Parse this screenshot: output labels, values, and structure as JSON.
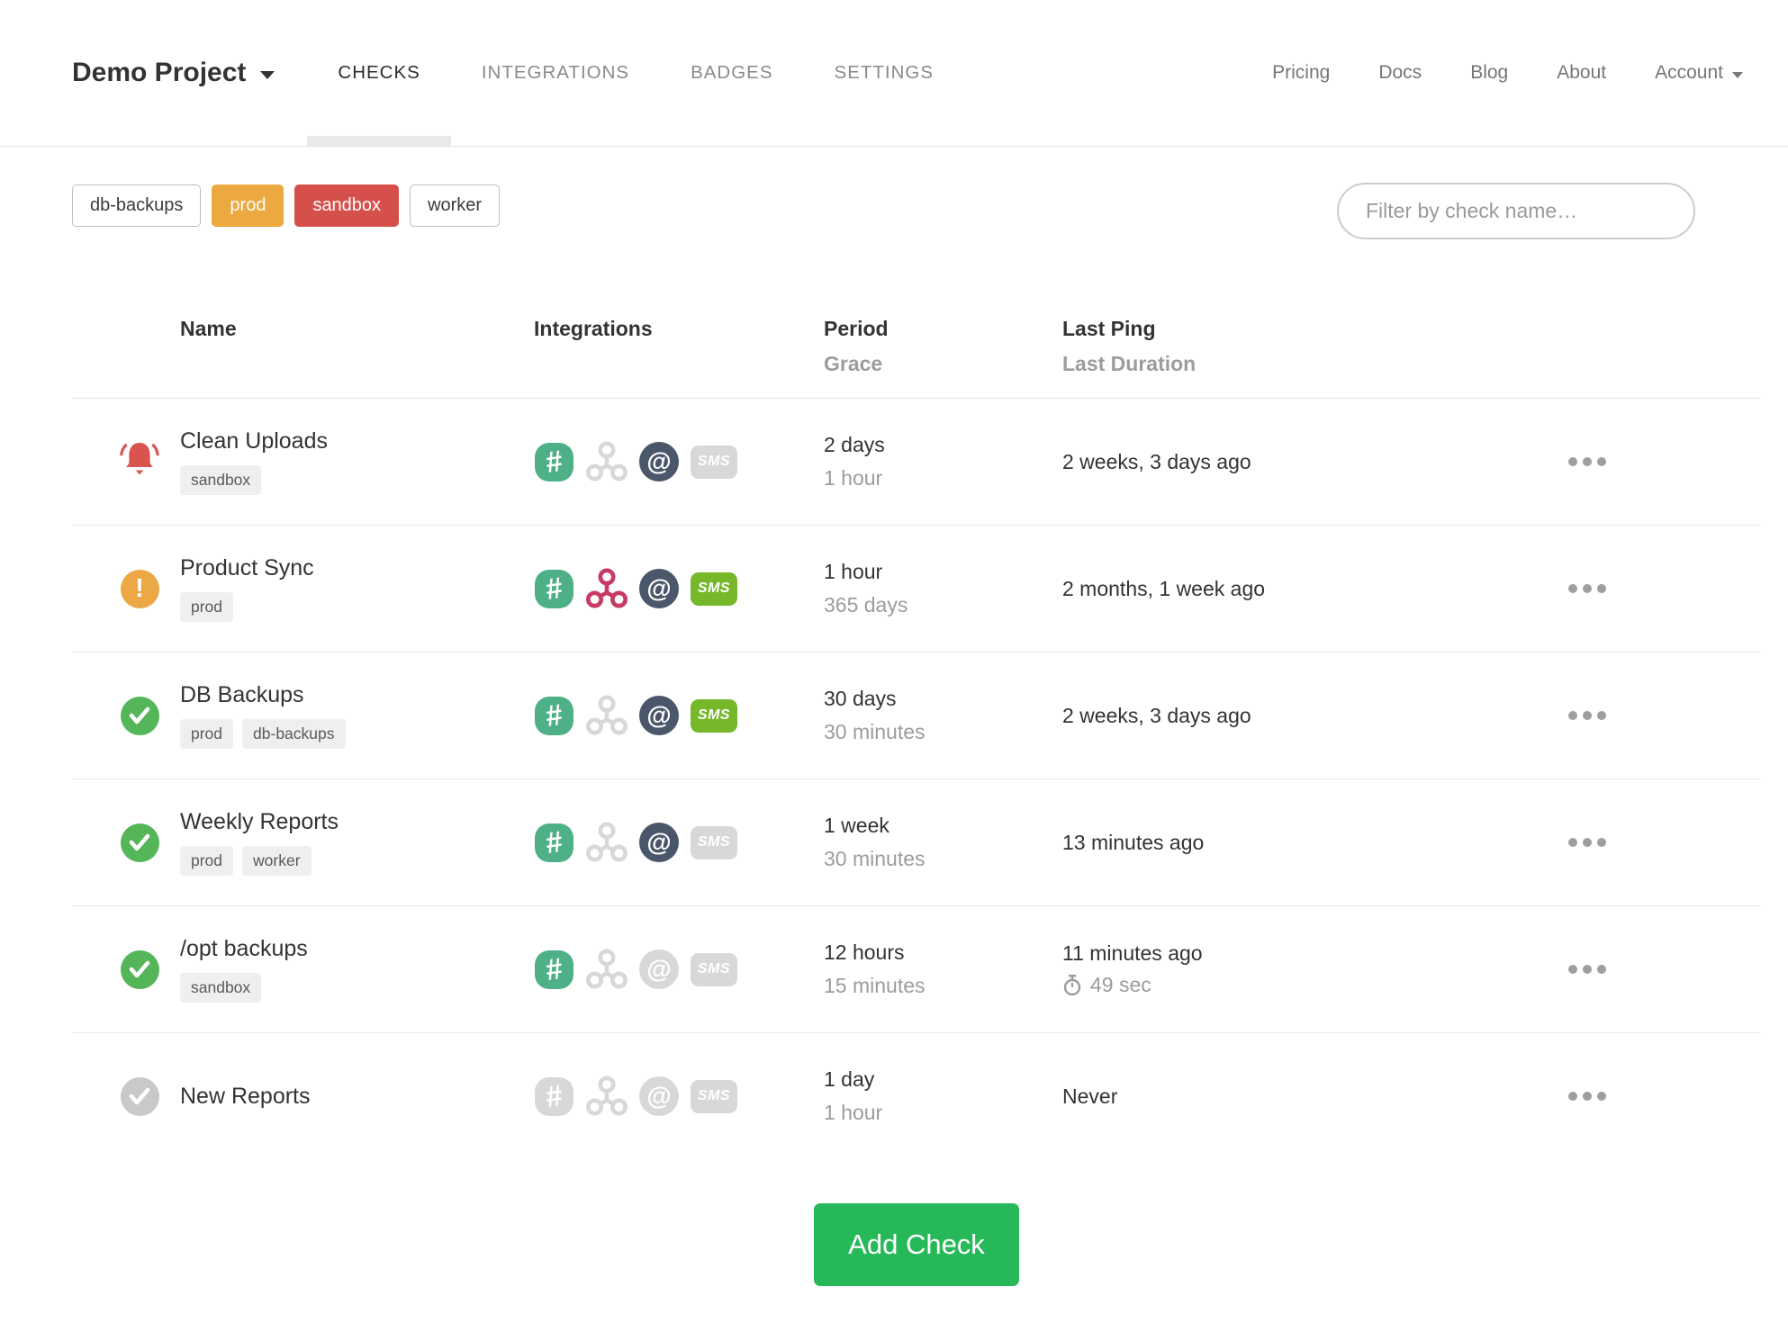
{
  "nav": {
    "project_name": "Demo Project",
    "tabs": [
      {
        "label": "CHECKS",
        "active": true
      },
      {
        "label": "INTEGRATIONS",
        "active": false
      },
      {
        "label": "BADGES",
        "active": false
      },
      {
        "label": "SETTINGS",
        "active": false
      }
    ],
    "links": [
      "Pricing",
      "Docs",
      "Blog",
      "About"
    ],
    "account_label": "Account"
  },
  "filters": {
    "tags": [
      {
        "label": "db-backups",
        "variant": "outline"
      },
      {
        "label": "prod",
        "variant": "warning"
      },
      {
        "label": "sandbox",
        "variant": "danger"
      },
      {
        "label": "worker",
        "variant": "outline"
      }
    ],
    "search_placeholder": "Filter by check name…"
  },
  "table": {
    "headers": {
      "name": "Name",
      "integrations": "Integrations",
      "period": "Period",
      "grace": "Grace",
      "last_ping": "Last Ping",
      "last_duration": "Last Duration"
    },
    "rows": [
      {
        "status": "alert",
        "name": "Clean Uploads",
        "tags": [
          "sandbox"
        ],
        "integrations": [
          {
            "type": "slack",
            "active": true
          },
          {
            "type": "webhook",
            "active": false
          },
          {
            "type": "email",
            "active": true
          },
          {
            "type": "sms",
            "active": false
          }
        ],
        "period": "2 days",
        "grace": "1 hour",
        "last_ping": "2 weeks, 3 days ago",
        "last_duration": ""
      },
      {
        "status": "warning",
        "name": "Product Sync",
        "tags": [
          "prod"
        ],
        "integrations": [
          {
            "type": "slack",
            "active": true
          },
          {
            "type": "webhook",
            "active": true
          },
          {
            "type": "email",
            "active": true
          },
          {
            "type": "sms",
            "active": true
          }
        ],
        "period": "1 hour",
        "grace": "365 days",
        "last_ping": "2 months, 1 week ago",
        "last_duration": ""
      },
      {
        "status": "ok",
        "name": "DB Backups",
        "tags": [
          "prod",
          "db-backups"
        ],
        "integrations": [
          {
            "type": "slack",
            "active": true
          },
          {
            "type": "webhook",
            "active": false
          },
          {
            "type": "email",
            "active": true
          },
          {
            "type": "sms",
            "active": true
          }
        ],
        "period": "30 days",
        "grace": "30 minutes",
        "last_ping": "2 weeks, 3 days ago",
        "last_duration": ""
      },
      {
        "status": "ok",
        "name": "Weekly Reports",
        "tags": [
          "prod",
          "worker"
        ],
        "integrations": [
          {
            "type": "slack",
            "active": true
          },
          {
            "type": "webhook",
            "active": false
          },
          {
            "type": "email",
            "active": true
          },
          {
            "type": "sms",
            "active": false
          }
        ],
        "period": "1 week",
        "grace": "30 minutes",
        "last_ping": "13 minutes ago",
        "last_duration": ""
      },
      {
        "status": "ok",
        "name": "/opt backups",
        "tags": [
          "sandbox"
        ],
        "integrations": [
          {
            "type": "slack",
            "active": true
          },
          {
            "type": "webhook",
            "active": false
          },
          {
            "type": "email",
            "active": false
          },
          {
            "type": "sms",
            "active": false
          }
        ],
        "period": "12 hours",
        "grace": "15 minutes",
        "last_ping": "11 minutes ago",
        "last_duration": "49 sec"
      },
      {
        "status": "new",
        "name": "New Reports",
        "tags": [],
        "integrations": [
          {
            "type": "slack",
            "active": false
          },
          {
            "type": "webhook",
            "active": false
          },
          {
            "type": "email",
            "active": false
          },
          {
            "type": "sms",
            "active": false
          }
        ],
        "period": "1 day",
        "grace": "1 hour",
        "last_ping": "Never",
        "last_duration": ""
      }
    ]
  },
  "add_check": {
    "label": "Add Check"
  },
  "colors": {
    "alert": "#D9534F",
    "warning": "#ECA845",
    "ok": "#55B559",
    "new_gray": "#C9C9C9",
    "slack": "#4DB087",
    "webhook": "#C73A63",
    "email": "#4A5669",
    "sms": "#76B82A",
    "inactive": "#D8D8D8",
    "add_button": "#27B959",
    "tag_warning": "#EBA93F",
    "tag_danger": "#D6504B"
  }
}
